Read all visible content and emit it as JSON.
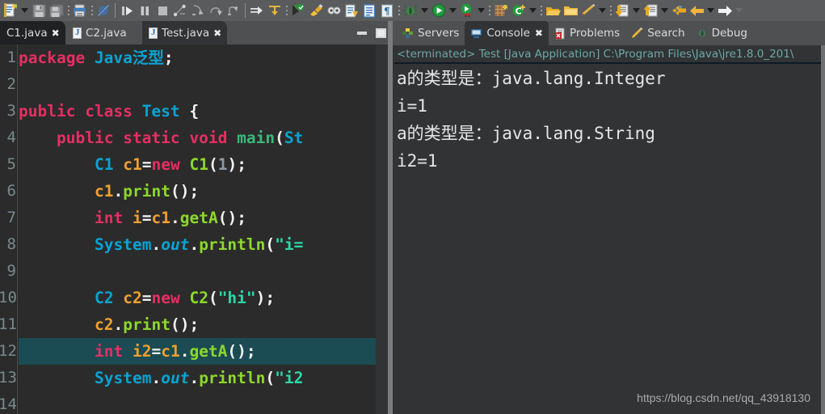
{
  "toolbar": {
    "items": [
      {
        "name": "new-wizard-icon",
        "kind": "icon",
        "glyph": "new"
      },
      {
        "name": "new-wizard-dropdown-arrow-icon",
        "kind": "arrow"
      },
      {
        "name": "save-icon",
        "kind": "icon",
        "glyph": "save"
      },
      {
        "name": "save-all-icon",
        "kind": "icon",
        "glyph": "saveall"
      },
      {
        "name": "toolbar-drag-dots",
        "kind": "dots"
      },
      {
        "name": "print-icon",
        "kind": "icon",
        "glyph": "print"
      },
      {
        "name": "toolbar-drag-dots",
        "kind": "dots"
      },
      {
        "name": "skip-all-breakpoints-icon",
        "kind": "icon",
        "glyph": "nobreak"
      },
      {
        "name": "toolbar-separator",
        "kind": "sep"
      },
      {
        "name": "resume-icon",
        "kind": "icon",
        "glyph": "resume"
      },
      {
        "name": "suspend-icon",
        "kind": "icon",
        "glyph": "suspend"
      },
      {
        "name": "terminate-icon",
        "kind": "icon",
        "glyph": "stop"
      },
      {
        "name": "disconnect-icon",
        "kind": "icon",
        "glyph": "disconnect"
      },
      {
        "name": "step-into-icon",
        "kind": "icon",
        "glyph": "stepinto"
      },
      {
        "name": "step-over-icon",
        "kind": "icon",
        "glyph": "stepover"
      },
      {
        "name": "step-return-icon",
        "kind": "icon",
        "glyph": "stepreturn"
      },
      {
        "name": "toolbar-separator",
        "kind": "sep"
      },
      {
        "name": "run-to-line-icon",
        "kind": "icon",
        "glyph": "runtoline"
      },
      {
        "name": "drop-to-frame-icon",
        "kind": "icon",
        "glyph": "droptoframe"
      },
      {
        "name": "toolbar-drag-dots",
        "kind": "dots"
      },
      {
        "name": "new-java-class-icon",
        "kind": "icon",
        "glyph": "newclass"
      },
      {
        "name": "open-type-icon",
        "kind": "icon",
        "glyph": "brush"
      },
      {
        "name": "toggle-mark-occurrences-icon",
        "kind": "icon",
        "glyph": "occur"
      },
      {
        "name": "new-java-project-icon",
        "kind": "icon",
        "glyph": "newproj"
      },
      {
        "name": "open-task-icon",
        "kind": "icon",
        "glyph": "tasklist"
      },
      {
        "name": "pilcrow-icon",
        "kind": "icon",
        "glyph": "pilcrow"
      },
      {
        "name": "toolbar-drag-dots",
        "kind": "dots"
      },
      {
        "name": "debug-icon",
        "kind": "icon",
        "glyph": "bug"
      },
      {
        "name": "debug-dropdown-arrow-icon",
        "kind": "arrow"
      },
      {
        "name": "run-icon",
        "kind": "icon",
        "glyph": "play"
      },
      {
        "name": "run-dropdown-arrow-icon",
        "kind": "arrow"
      },
      {
        "name": "external-tools-icon",
        "kind": "icon",
        "glyph": "exttools"
      },
      {
        "name": "external-tools-dropdown-arrow-icon",
        "kind": "arrow"
      },
      {
        "name": "toolbar-drag-dots",
        "kind": "dots"
      },
      {
        "name": "new-package-icon",
        "kind": "icon",
        "glyph": "package"
      },
      {
        "name": "new-class-wizard-icon",
        "kind": "icon",
        "glyph": "cclass"
      },
      {
        "name": "new-class-dropdown-arrow-icon",
        "kind": "arrow"
      },
      {
        "name": "toolbar-drag-dots",
        "kind": "dots"
      },
      {
        "name": "open-folder-icon",
        "kind": "icon",
        "glyph": "folderopen"
      },
      {
        "name": "folder-icon",
        "kind": "icon",
        "glyph": "folder"
      },
      {
        "name": "quick-fix-icon",
        "kind": "icon",
        "glyph": "pencil"
      },
      {
        "name": "quick-fix-dropdown-arrow-icon",
        "kind": "arrow"
      },
      {
        "name": "toolbar-drag-dots",
        "kind": "dots"
      },
      {
        "name": "next-annotation-icon",
        "kind": "icon",
        "glyph": "nextanno"
      },
      {
        "name": "next-annotation-dropdown-arrow-icon",
        "kind": "arrow"
      },
      {
        "name": "previous-annotation-icon",
        "kind": "icon",
        "glyph": "prevanno"
      },
      {
        "name": "previous-annotation-dropdown-arrow-icon",
        "kind": "arrow"
      },
      {
        "name": "back-history-icon",
        "kind": "icon",
        "glyph": "backyellow"
      },
      {
        "name": "back-arrow-icon",
        "kind": "icon",
        "glyph": "leftarrow"
      },
      {
        "name": "back-dropdown-arrow-icon",
        "kind": "arrow"
      },
      {
        "name": "forward-arrow-icon",
        "kind": "icon",
        "glyph": "rightarrow"
      },
      {
        "name": "forward-dropdown-arrow-icon",
        "kind": "arrow-disabled"
      }
    ]
  },
  "editor": {
    "tabs": [
      {
        "label": "C1.java",
        "closable": true,
        "state": "dirty",
        "show_file_icon": false
      },
      {
        "label": "C2.java",
        "closable": false,
        "state": "normal",
        "show_file_icon": true
      },
      {
        "label": "Test.java",
        "closable": true,
        "state": "active",
        "show_file_icon": true
      }
    ],
    "window_buttons": {
      "minimize": "minimize-editor",
      "maximize": "maximize-editor"
    },
    "line_numbers": [
      "1",
      "2",
      "3",
      "4",
      "5",
      "6",
      "7",
      "8",
      "9",
      "10",
      "11",
      "12",
      "13",
      "14"
    ],
    "highlighted_line": 12,
    "lines": [
      {
        "n": 1,
        "text": "package Java泛型;"
      },
      {
        "n": 2,
        "text": ""
      },
      {
        "n": 3,
        "text": "public class Test {"
      },
      {
        "n": 4,
        "text": "    public static void main(St"
      },
      {
        "n": 5,
        "text": "        C1 c1=new C1(1);"
      },
      {
        "n": 6,
        "text": "        c1.print();"
      },
      {
        "n": 7,
        "text": "        int i=c1.getA();"
      },
      {
        "n": 8,
        "text": "        System.out.println(\"i="
      },
      {
        "n": 9,
        "text": ""
      },
      {
        "n": 10,
        "text": "        C2 c2=new C2(\"hi\");"
      },
      {
        "n": 11,
        "text": "        c2.print();"
      },
      {
        "n": 12,
        "text": "        int i2=c1.getA();"
      },
      {
        "n": 13,
        "text": "        System.out.println(\"i2"
      },
      {
        "n": 14,
        "text": ""
      }
    ]
  },
  "console_view": {
    "tabs": [
      {
        "label": "Servers",
        "icon": "servers-icon",
        "active": false,
        "closable": false
      },
      {
        "label": "Console",
        "icon": "console-icon",
        "active": true,
        "closable": true
      },
      {
        "label": "Problems",
        "icon": "problems-icon",
        "active": false,
        "closable": false
      },
      {
        "label": "Search",
        "icon": "search-icon",
        "active": false,
        "closable": false
      },
      {
        "label": "Debug",
        "icon": "debug-icon",
        "active": false,
        "closable": false
      }
    ],
    "launch_header": "<terminated> Test [Java Application] C:\\Program Files\\Java\\jre1.8.0_201\\",
    "output": "a的类型是：java.lang.Integer\ni=1\na的类型是：java.lang.String\ni2=1"
  },
  "watermark": "https://blog.csdn.net/qq_43918130",
  "colors": {
    "toolbar_bg": "#595b5d",
    "tabbar_bg": "#4e5052",
    "editor_bg": "#2b2b2b",
    "panel_bg": "#313335",
    "active_tab_bg": "#313335",
    "dirty_tab_bg": "#1f2123",
    "line_highlight": "#1b4b53",
    "keyword": "#e52f63",
    "type": "#0aa3d2",
    "method": "#8dd82c",
    "variable": "#f0a030",
    "string": "#2cd8a8",
    "number": "#8b9aa4",
    "plain_text": "#f4f4f4",
    "line_number": "#7a8a8c",
    "launch_header_text": "#6fa8a6",
    "console_text": "#e4e6e8",
    "watermark_text": "#a8aaac",
    "divider": "#7a7c7e"
  }
}
